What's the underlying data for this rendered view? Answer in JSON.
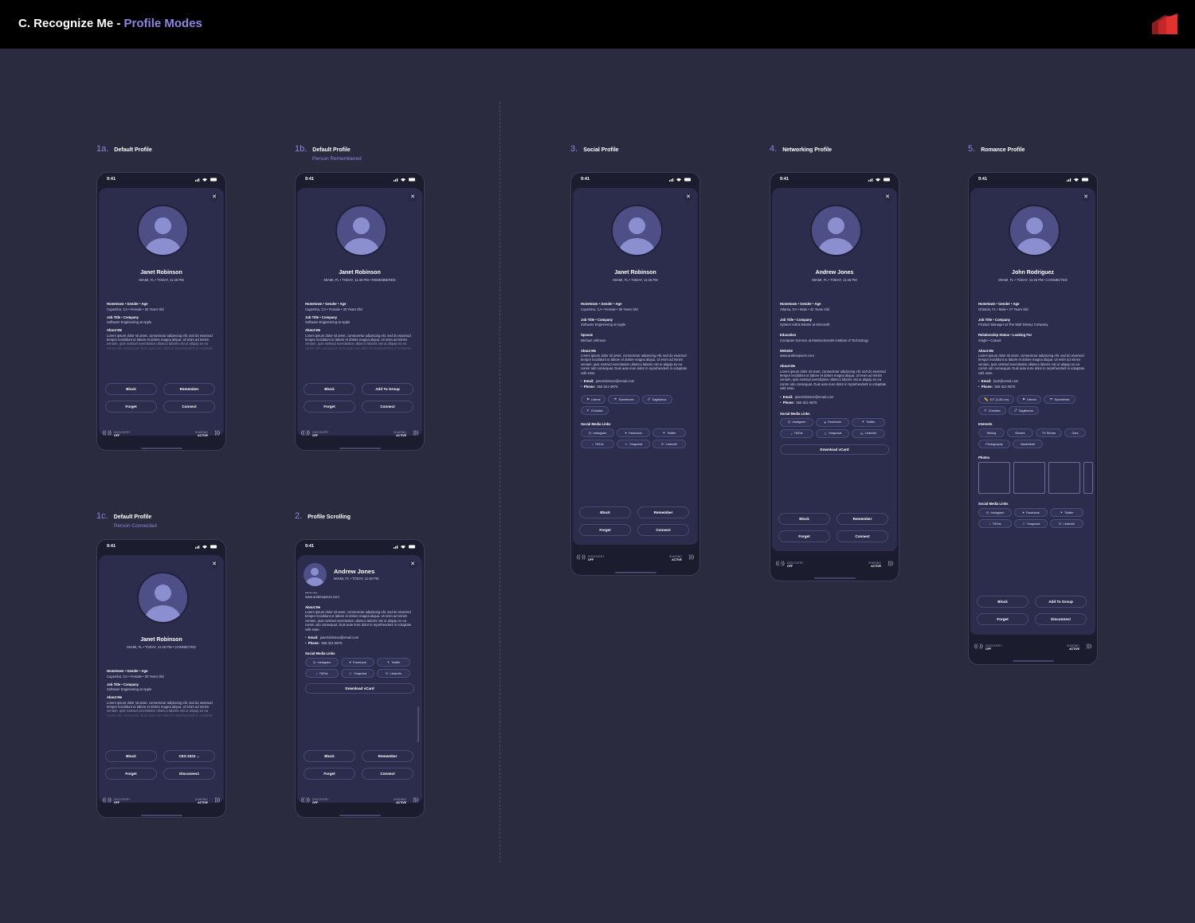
{
  "header": {
    "title": "C.  Recognize Me - ",
    "title_highlight": "Profile Modes"
  },
  "status_time": "9:41",
  "nav": {
    "discovery_label": "DISCOVERY",
    "discovery_state": "OFF",
    "sharing_label": "SHARING",
    "sharing_state": "ACTIVE"
  },
  "common": {
    "hometown_label": "Hometown • Gender • Age",
    "job_label": "Job Title • Company",
    "about_label": "About Me",
    "social_label": "Social Media Links",
    "about_text": "Lorem ipsum dolor sit amet, consectetur adipiscing elit, sed do eiusmod tempor incididunt ut labore et dolore magna aliqua. Ut enim ad minim veniam, quis nostrud exercitation ullamco laboris nisi ut aliquip ex ea comm odo consequat. Duis aute irure dolor in reprehenderit in voluptate velit esse.",
    "email_label": "Email:",
    "phone_label": "Phone:",
    "phone_value": "555-321-9876",
    "email_janet": "janetrobinson@email.com",
    "social": {
      "instagram": "Instagram",
      "facebook": "Facebook",
      "twitter": "Twitter",
      "tiktok": "TikTok",
      "snapchat": "Snapchat",
      "linkedin": "LinkedIn"
    },
    "download_vcard": "Download vCard"
  },
  "screens": {
    "s1a": {
      "num": "1a.",
      "title": "Default Profile",
      "name": "Janet Robinson",
      "meta": "MIAMI, FL  •  TODAY, 11:46 PM",
      "hometown": "Cupertino, CA  •  Female  •  30 Years Old",
      "job": "Software Engineering at Apple",
      "buttons": [
        "Block",
        "Remember",
        "Forget",
        "Connect"
      ]
    },
    "s1b": {
      "num": "1b.",
      "title": "Default Profile",
      "subtitle": "Person Remembered",
      "name": "Janet Robinson",
      "meta": "MIAMI, FL  •  TODAY, 11:46 PM  •  REMEMBERED",
      "hometown": "Cupertino, CA  •  Female  •  30 Years Old",
      "job": "Software Engineering at Apple",
      "buttons": [
        "Block",
        "Add To Group",
        "Forget",
        "Connect"
      ]
    },
    "s1c": {
      "num": "1c.",
      "title": "Default Profile",
      "subtitle": "Person Connected",
      "name": "Janet Robinson",
      "meta": "MIAMI, FL  •  TODAY, 11:46 PM  •  CONNECTED",
      "hometown": "Cupertino, CA  •  Female  •  30 Years Old",
      "job": "Software Engineering at Apple",
      "buttons": [
        "Block",
        "CES 2022",
        "Forget",
        "Disconnect"
      ]
    },
    "s2": {
      "num": "2.",
      "title": "Profile Scrolling",
      "name": "Andrew Jones",
      "meta": "MIAMI, FL  •  TODAY, 11:46 PM",
      "cut_label": "Website",
      "website": "www.andrewjones.com",
      "buttons": [
        "Block",
        "Remember",
        "Forget",
        "Connect"
      ]
    },
    "s3": {
      "num": "3.",
      "title": "Social Profile",
      "name": "Janet Robinson",
      "meta": "MIAMI, FL  •  TODAY, 11:46 PM",
      "hometown": "Cupertino, CA  •  Female  •  30 Years Old",
      "job": "Software Engineering at Apple",
      "spouse_label": "Spouse",
      "spouse": "Michael Johnson",
      "tags": [
        "Liberal",
        "Sometimes",
        "Sagittarius",
        "Christian"
      ],
      "buttons": [
        "Block",
        "Remember",
        "Forget",
        "Connect"
      ]
    },
    "s4": {
      "num": "4.",
      "title": "Networking Profile",
      "name": "Andrew Jones",
      "meta": "MIAMI, FL  •  TODAY, 11:46 PM",
      "hometown": "Atlanta, GA  •  Male  •  42 Years Old",
      "job": "System Administrator at Microsoft",
      "education_label": "Education",
      "education": "Computer Science at Massachusetts Institute of Technology",
      "website_label": "Website",
      "website": "www.andrewjones.com",
      "buttons": [
        "Block",
        "Remember",
        "Forget",
        "Connect"
      ]
    },
    "s5": {
      "num": "5.",
      "title": "Romance Profile",
      "name": "John Rodriguez",
      "meta": "MIAMI, FL  •  TODAY, 11:46 PM  •  CONNECTED",
      "hometown": "Orlando, FL  •  Male  •  27 Years Old",
      "job": "Product Manager at The Walt Disney Company",
      "rel_label": "Relationship Status  •  Looking For",
      "rel": "Single  •  Casual",
      "email": "jrodr@email.com",
      "tags": [
        "6'1\" (1.85 cm)",
        "Liberal",
        "Sometimes",
        "Christian",
        "Sagittarius"
      ],
      "interests_label": "Interests",
      "interests": [
        "Writing",
        "Movies",
        "TV Shows",
        "Cars",
        "Photography",
        "Basketball"
      ],
      "photos_label": "Photos",
      "buttons": [
        "Block",
        "Add To Group",
        "Forget",
        "Disconnect"
      ]
    }
  }
}
